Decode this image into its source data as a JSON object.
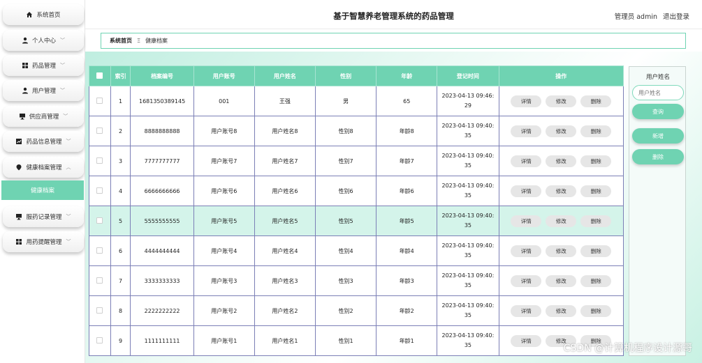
{
  "sidebar": {
    "items": [
      {
        "label": "系统首页",
        "icon": "home-icon",
        "chevron": ""
      },
      {
        "label": "个人中心",
        "icon": "user-icon",
        "chevron": "﹀"
      },
      {
        "label": "药品管理",
        "icon": "grid-icon",
        "chevron": "﹀"
      },
      {
        "label": "用户管理",
        "icon": "user-icon",
        "chevron": "﹀"
      },
      {
        "label": "供应商管理",
        "icon": "monitor-icon",
        "chevron": "﹀"
      },
      {
        "label": "药品信息管理",
        "icon": "chart-icon",
        "chevron": "﹀"
      },
      {
        "label": "健康档案管理",
        "icon": "location-icon",
        "chevron": "︿"
      },
      {
        "label": "服药记录管理",
        "icon": "monitor-icon",
        "chevron": "﹀"
      },
      {
        "label": "用药提醒管理",
        "icon": "grid-icon",
        "chevron": "﹀"
      }
    ],
    "active_sub": "健康档案"
  },
  "header": {
    "title": "基于智慧养老管理系统的药品管理",
    "user": "管理员 admin",
    "logout": "退出登录"
  },
  "breadcrumb": {
    "home": "系统首页",
    "sep": "Ξ",
    "current": "健康档案"
  },
  "table": {
    "headers": [
      "索引",
      "档案编号",
      "用户账号",
      "用户姓名",
      "性别",
      "年龄",
      "登记时间",
      "操作"
    ],
    "actions": [
      "详情",
      "修改",
      "删除"
    ],
    "rows": [
      {
        "idx": "1",
        "no": "1681350389145",
        "account": "001",
        "name": "王强",
        "gender": "男",
        "age": "65",
        "time": "2023-04-13 09:46:",
        "time2": "29"
      },
      {
        "idx": "2",
        "no": "8888888888",
        "account": "用户账号8",
        "name": "用户姓名8",
        "gender": "性别8",
        "age": "年龄8",
        "time": "2023-04-13 09:40:",
        "time2": "35"
      },
      {
        "idx": "3",
        "no": "7777777777",
        "account": "用户账号7",
        "name": "用户姓名7",
        "gender": "性别7",
        "age": "年龄7",
        "time": "2023-04-13 09:40:",
        "time2": "35"
      },
      {
        "idx": "4",
        "no": "6666666666",
        "account": "用户账号6",
        "name": "用户姓名6",
        "gender": "性别6",
        "age": "年龄6",
        "time": "2023-04-13 09:40:",
        "time2": "35"
      },
      {
        "idx": "5",
        "no": "5555555555",
        "account": "用户账号5",
        "name": "用户姓名5",
        "gender": "性别5",
        "age": "年龄5",
        "time": "2023-04-13 09:40:",
        "time2": "35"
      },
      {
        "idx": "6",
        "no": "4444444444",
        "account": "用户账号4",
        "name": "用户姓名4",
        "gender": "性别4",
        "age": "年龄4",
        "time": "2023-04-13 09:40:",
        "time2": "35"
      },
      {
        "idx": "7",
        "no": "3333333333",
        "account": "用户账号3",
        "name": "用户姓名3",
        "gender": "性别3",
        "age": "年龄3",
        "time": "2023-04-13 09:40:",
        "time2": "35"
      },
      {
        "idx": "8",
        "no": "2222222222",
        "account": "用户账号2",
        "name": "用户姓名2",
        "gender": "性别2",
        "age": "年龄2",
        "time": "2023-04-13 09:40:",
        "time2": "35"
      },
      {
        "idx": "9",
        "no": "1111111111",
        "account": "用户账号1",
        "name": "用户姓名1",
        "gender": "性别1",
        "age": "年龄1",
        "time": "2023-04-13 09:40:",
        "time2": "35"
      }
    ],
    "selected_row": "5"
  },
  "search_panel": {
    "label": "用户姓名",
    "placeholder": "用户姓名",
    "query": "查询",
    "add": "新增",
    "delete": "删除"
  },
  "watermark": "CSDN @计算机程序设计源哥",
  "colors": {
    "accent": "#6fd3b2",
    "selected_row": "#d4f4ea"
  }
}
